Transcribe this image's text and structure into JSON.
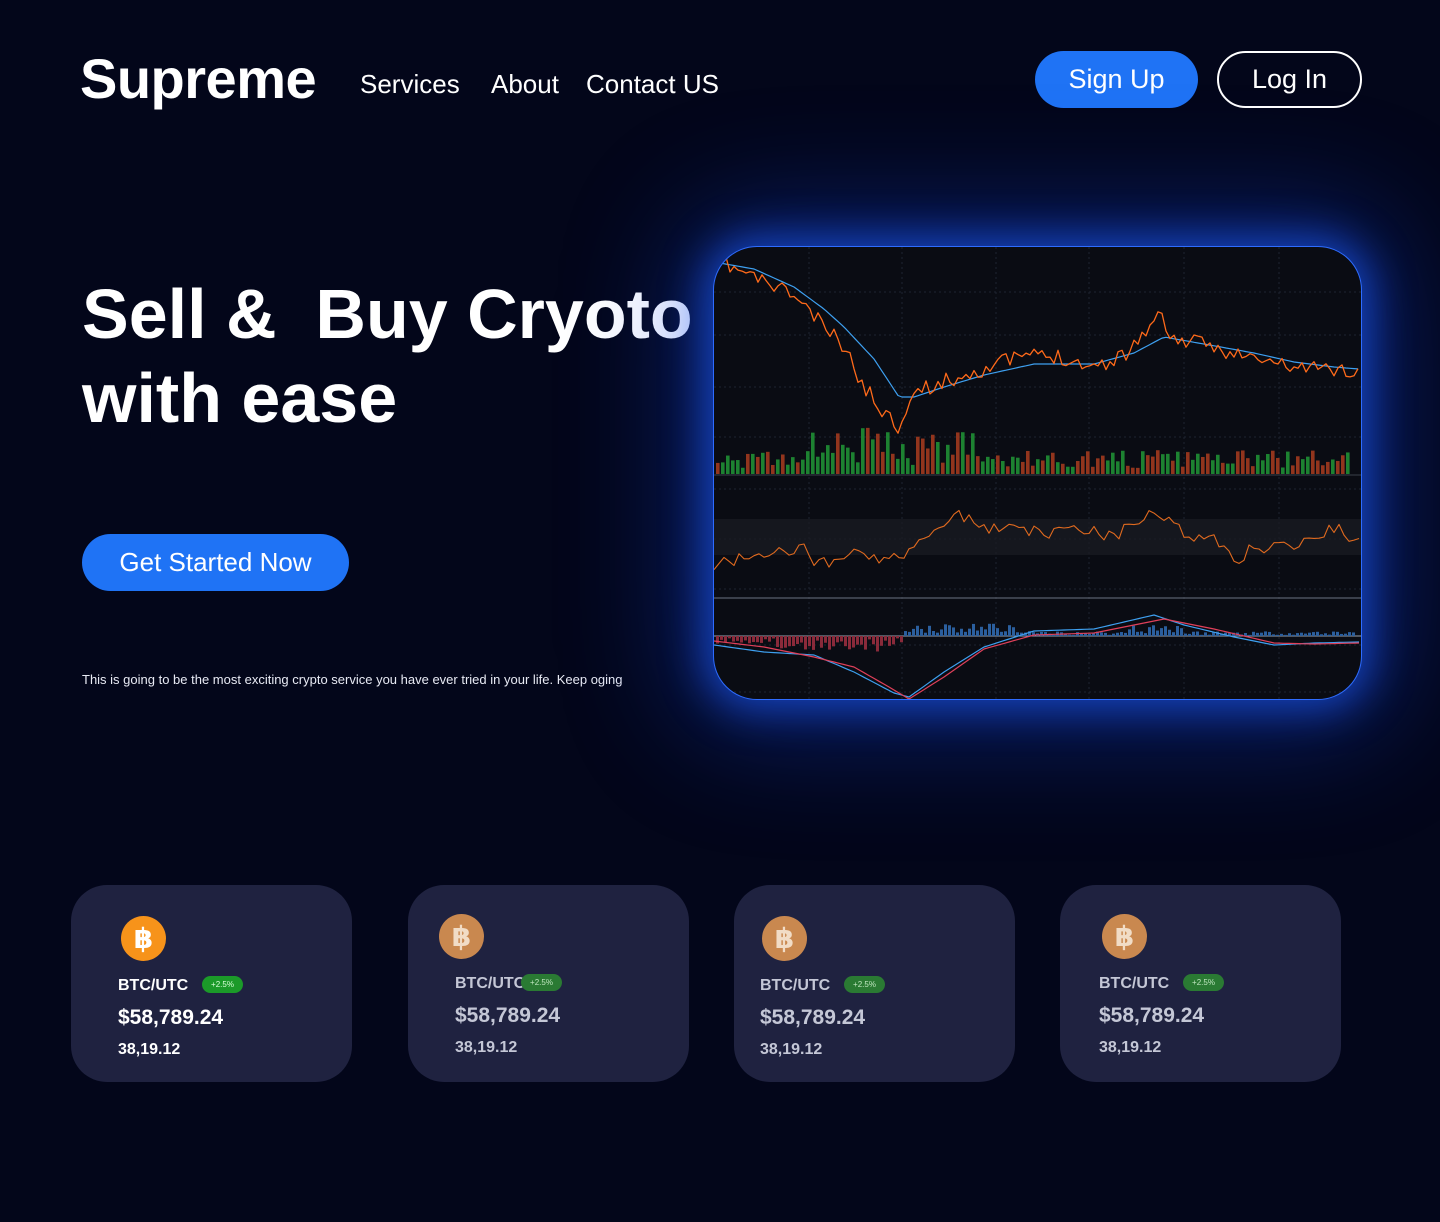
{
  "header": {
    "logo": "Supreme",
    "nav": [
      "Services",
      "About",
      "Contact US"
    ],
    "sign_up": "Sign Up",
    "log_in": "Log In"
  },
  "hero": {
    "title_line1": "Sell &  Buy Cryoto",
    "title_line2": "with ease",
    "cta": "Get Started Now",
    "tagline": "This is going to be the most exciting crypto service you have ever tried in your life. Keep oging"
  },
  "colors": {
    "background": "#03061a",
    "accent": "#1f73f5",
    "card": "#1f2240",
    "badge": "#1b9a29",
    "bitcoin": "#f7931a"
  },
  "cards": [
    {
      "icon": "bitcoin-icon",
      "pair": "BTC/UTC",
      "change": "+2.5%",
      "price": "$58,789.24",
      "sub": "38,19.12"
    },
    {
      "icon": "bitcoin-icon",
      "pair": "BTC/UTC",
      "change": "+2.5%",
      "price": "$58,789.24",
      "sub": "38,19.12"
    },
    {
      "icon": "bitcoin-icon",
      "pair": "BTC/UTC",
      "change": "+2.5%",
      "price": "$58,789.24",
      "sub": "38,19.12"
    },
    {
      "icon": "bitcoin-icon",
      "pair": "BTC/UTC",
      "change": "+2.5%",
      "price": "$58,789.24",
      "sub": "38,19.12"
    }
  ]
}
